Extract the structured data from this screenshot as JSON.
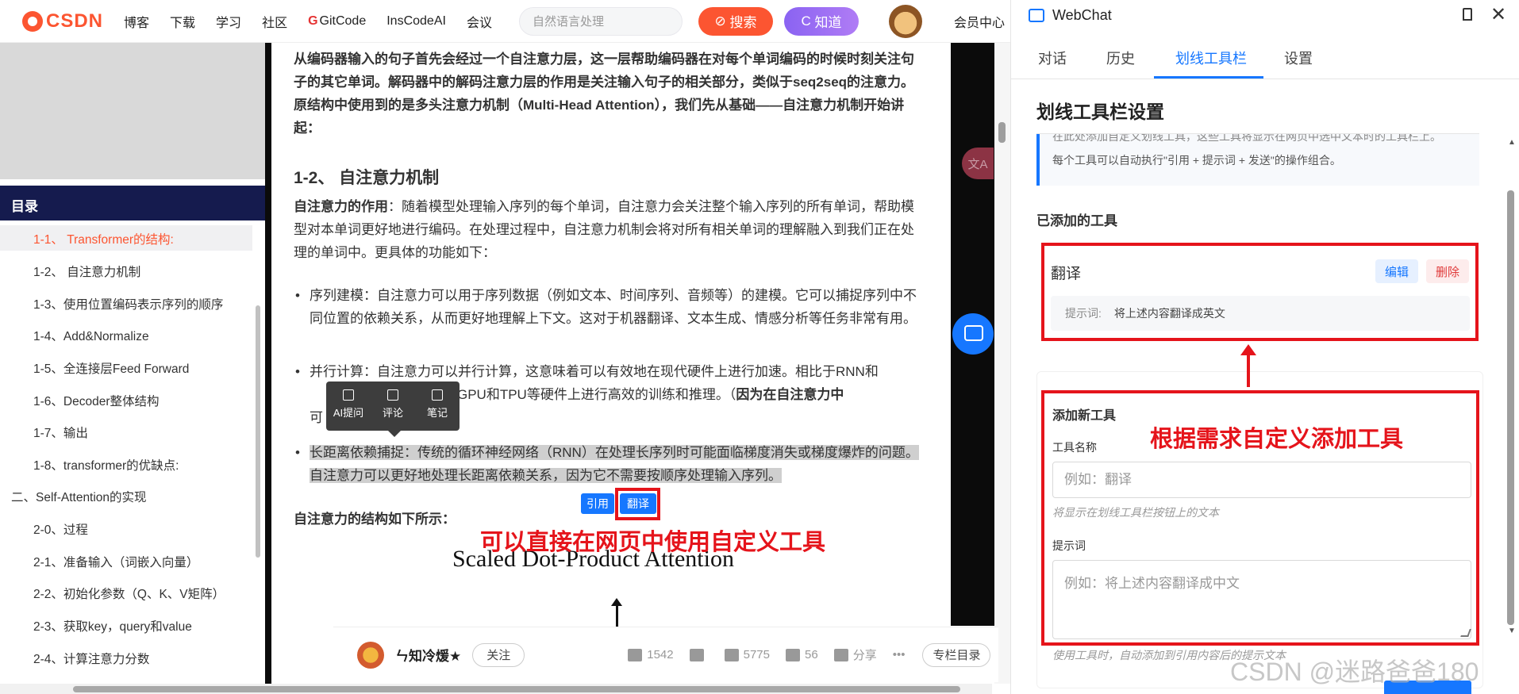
{
  "nav": {
    "logo": "CSDN",
    "items": [
      "博客",
      "下载",
      "学习",
      "社区",
      "GitCode",
      "InsCodeAI",
      "会议"
    ],
    "search_placeholder": "自然语言处理",
    "search_button": "搜索",
    "know_button": "知道",
    "member": "会员中心"
  },
  "toc": {
    "title": "目录",
    "items": [
      "1-1、 Transformer的结构:",
      "1-2、 自注意力机制",
      "1-3、使用位置编码表示序列的顺序",
      "1-4、Add&Normalize",
      "1-5、全连接层Feed Forward",
      "1-6、Decoder整体结构",
      "1-7、输出",
      "1-8、transformer的优缺点:",
      "二、Self-Attention的实现",
      "2-0、过程",
      "2-1、准备输入（词嵌入向量）",
      "2-2、初始化参数（Q、K、V矩阵）",
      "2-3、获取key，query和value",
      "2-4、计算注意力分数"
    ]
  },
  "article": {
    "intro": "从编码器输入的句子首先会经过一个自注意力层，这一层帮助编码器在对每个单词编码的时候时刻关注句子的其它单词。解码器中的解码注意力层的作用是关注输入句子的相关部分，类似于seq2seq的注意力。原结构中使用到的是多头注意力机制（Multi-Head Attention），我们先从基础——自注意力机制开始讲起：",
    "heading": "1-2、 自注意力机制",
    "role_label": "自注意力的作用",
    "role_text": "：随着模型处理输入序列的每个单词，自注意力会关注整个输入序列的所有单词，帮助模型对本单词更好地进行编码。在处理过程中，自注意力机制会将对所有相关单词的理解融入到我们正在处理的单词中。更具体的功能如下：",
    "bullet1": "序列建模：自注意力可以用于序列数据（例如文本、时间序列、音频等）的建模。它可以捕捉序列中不同位置的依赖关系，从而更好地理解上下文。这对于机器翻译、文本生成、情感分析等任务非常有用。",
    "bullet2_a": "并行计算：自注意力可以并行计算，这意味着可以有效地在现代硬件上进行加速。相比于RNN和",
    "bullet2_b": "更容易在GPU和TPU等硬件上进行高效的训练和推理。（",
    "bullet2_bold": "因为在自注意力中",
    "bullet2_c": "可",
    "bullet3": "长距离依赖捕捉：传统的循环神经网络（RNN）在处理长序列时可能面临梯度消失或梯度爆炸的问题。自注意力可以更好地处理长距离依赖关系，因为它不需要按顺序处理输入序列。",
    "structure": "自注意力的结构如下所示：",
    "formula_title": "Scaled Dot-Product Attention"
  },
  "selection_toolbar": {
    "ai": "AI提问",
    "comment": "评论",
    "note": "笔记"
  },
  "inline_tools": {
    "quote": "引用",
    "translate": "翻译"
  },
  "annotations": {
    "left": "可以直接在网页中使用自定义工具",
    "right": "根据需求自定义添加工具"
  },
  "translate_fab": "文A",
  "author": {
    "name": "ㄣ知冷煖★",
    "follow": "关注",
    "likes": "1542",
    "stars": "5775",
    "comments": "56",
    "share": "分享",
    "more": "•••",
    "column": "专栏目录"
  },
  "panel": {
    "title": "WebChat",
    "close": "✕",
    "tabs": [
      "对话",
      "历史",
      "划线工具栏",
      "设置"
    ],
    "heading": "划线工具栏设置",
    "info_cut": "在此处添加自定义划线工具，这些工具将显示在网页中选中文本时的工具栏上。",
    "info": "每个工具可以自动执行\"引用 + 提示词 + 发送\"的操作组合。",
    "added_title": "已添加的工具",
    "tool": {
      "name": "翻译",
      "edit": "编辑",
      "delete": "删除",
      "prompt_label": "提示词:",
      "prompt": "将上述内容翻译成英文"
    },
    "new_title": "添加新工具",
    "name_label": "工具名称",
    "name_placeholder": "例如：翻译",
    "name_hint": "将显示在划线工具栏按钮上的文本",
    "prompt_label": "提示词",
    "prompt_placeholder": "例如：将上述内容翻译成中文",
    "prompt_hint": "使用工具时，自动添加到引用内容后的提示文本"
  },
  "watermark": "CSDN @迷路爸爸180"
}
